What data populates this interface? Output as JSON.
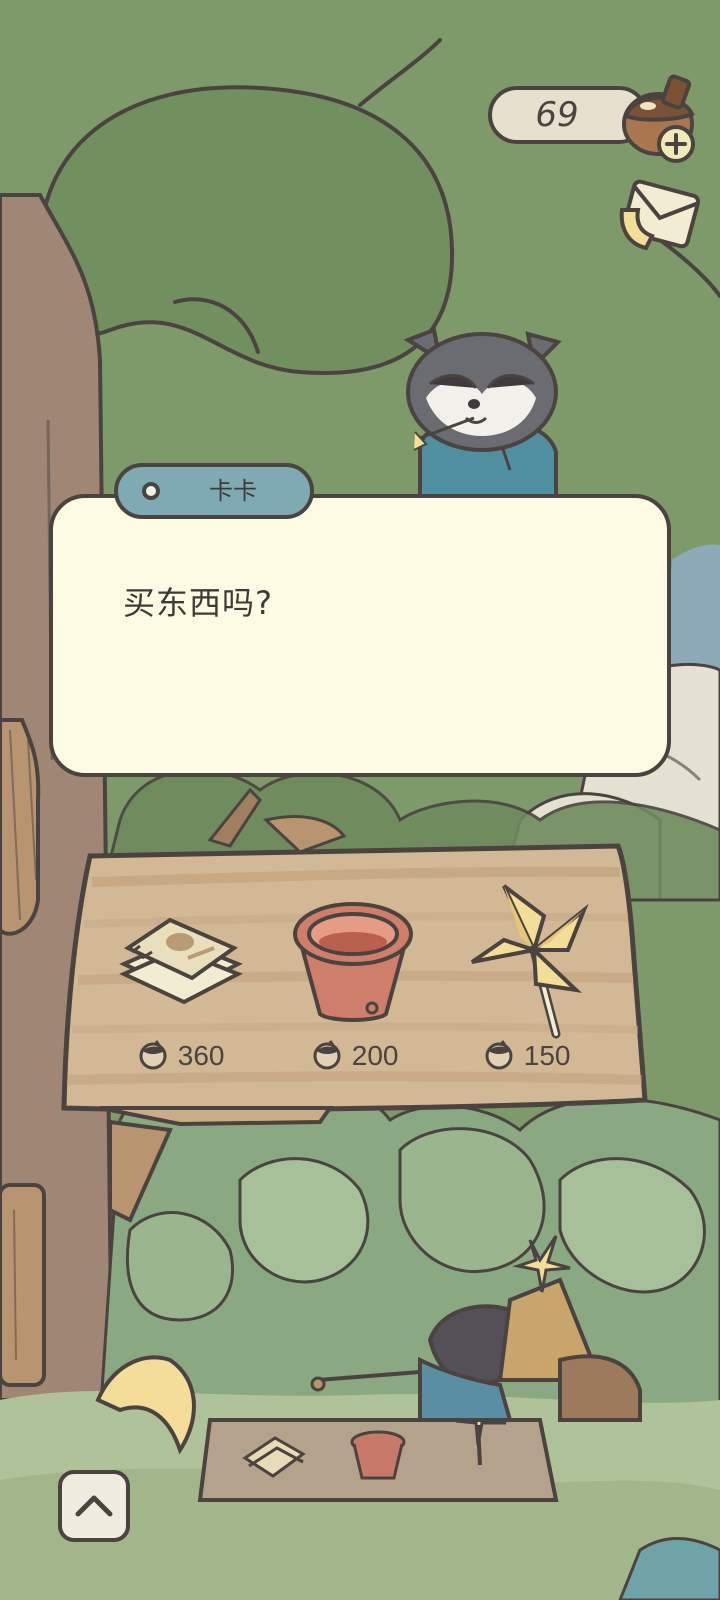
{
  "hud": {
    "acorn_count": "69"
  },
  "dialog": {
    "speaker": "卡卡",
    "text": "买东西吗?"
  },
  "shop": {
    "items": [
      {
        "name": "letter-paper",
        "price": "360"
      },
      {
        "name": "clay-pot",
        "price": "200"
      },
      {
        "name": "pinwheel",
        "price": "150"
      }
    ]
  },
  "icons": {
    "acorn": "acorn-icon",
    "add": "plus-icon",
    "mail": "mail-icon",
    "expand": "chevron-up-icon"
  },
  "colors": {
    "dialog_bg": "#fefbe5",
    "name_tab": "#7fa9b3",
    "outline": "#4b4340",
    "board": "#d3b895",
    "foliage": "#7e9a6b"
  }
}
